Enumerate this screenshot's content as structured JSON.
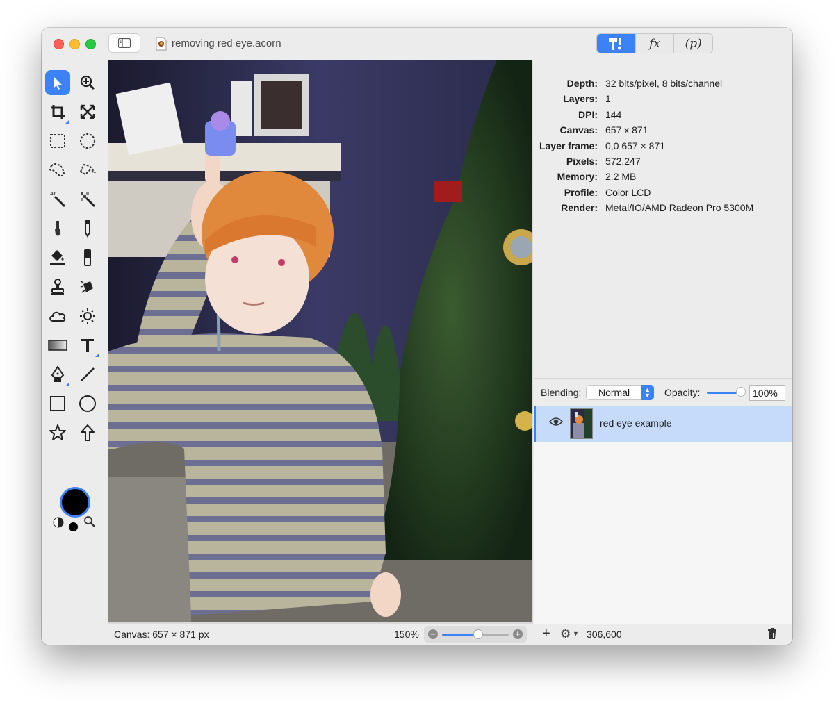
{
  "window": {
    "document_title": "removing red eye.acorn",
    "segments": [
      "",
      "fx",
      "(p)"
    ]
  },
  "info_panel": [
    {
      "key": "Depth:",
      "value": "32 bits/pixel, 8 bits/channel"
    },
    {
      "key": "Layers:",
      "value": "1"
    },
    {
      "key": "DPI:",
      "value": "144"
    },
    {
      "key": "Canvas:",
      "value": "657 x 871"
    },
    {
      "key": "Layer frame:",
      "value": "0,0 657 × 871"
    },
    {
      "key": "Pixels:",
      "value": "572,247"
    },
    {
      "key": "Memory:",
      "value": "2.2 MB"
    },
    {
      "key": "Profile:",
      "value": "Color LCD"
    },
    {
      "key": "Render:",
      "value": "Metal/IO/AMD Radeon Pro 5300M"
    }
  ],
  "blend": {
    "blending_label": "Blending:",
    "blending_value": "Normal",
    "opacity_label": "Opacity:",
    "opacity_value": "100%",
    "opacity_level": 1.0
  },
  "layers": [
    {
      "name": "red eye example",
      "visible": true,
      "selected": true
    }
  ],
  "status": {
    "canvas_info": "Canvas: 657 × 871 px",
    "zoom": "150%",
    "layer_stat": "306,600"
  },
  "colors": {
    "accent": "#3b82f6",
    "selection_bg": "#c6dafa",
    "foreground_color": "#000000"
  },
  "tools": [
    "select-arrow",
    "zoom",
    "crop",
    "transform",
    "rect-marquee",
    "ellipse-marquee",
    "lasso",
    "polygon-lasso",
    "magic-wand",
    "color-select",
    "brush",
    "pencil",
    "paint-bucket",
    "eraser",
    "clone-stamp",
    "retouch",
    "cloud",
    "sun",
    "gradient",
    "text",
    "pen",
    "line",
    "rectangle-shape",
    "oval-shape",
    "star-shape",
    "arrow-shape"
  ]
}
